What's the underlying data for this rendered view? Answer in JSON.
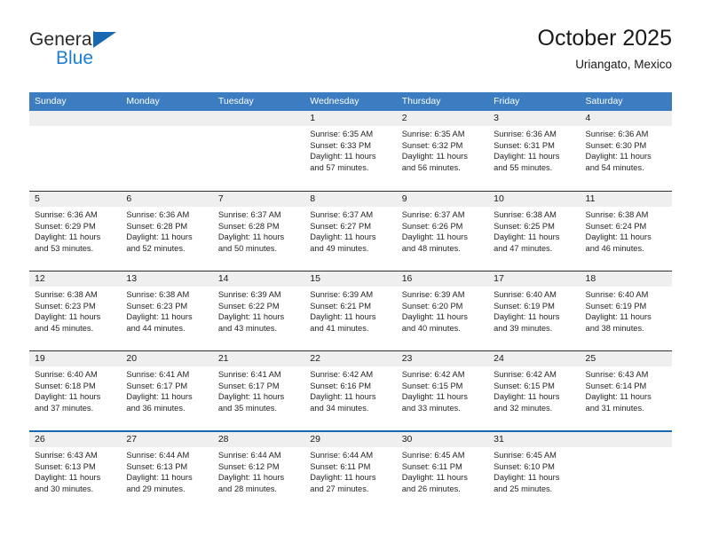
{
  "brand": {
    "name_part1": "General",
    "name_part2": "Blue",
    "flag_icon": "triangle-flag-icon"
  },
  "header": {
    "title": "October 2025",
    "subtitle": "Uriangato, Mexico"
  },
  "colors": {
    "header_blue": "#3b7dc0",
    "brand_blue": "#1d7fd4",
    "separator_blue": "#1668b3",
    "day_strip_grey": "#efefef",
    "week_border": "#2e2e2e"
  },
  "weekdays": [
    "Sunday",
    "Monday",
    "Tuesday",
    "Wednesday",
    "Thursday",
    "Friday",
    "Saturday"
  ],
  "labels": {
    "sunrise_prefix": "Sunrise:",
    "sunset_prefix": "Sunset:",
    "daylight_prefix": "Daylight:"
  },
  "weeks": [
    [
      {
        "day": "",
        "empty": true
      },
      {
        "day": "",
        "empty": true
      },
      {
        "day": "",
        "empty": true
      },
      {
        "day": "1",
        "line1": "Sunrise: 6:35 AM",
        "line2": "Sunset: 6:33 PM",
        "line3": "Daylight: 11 hours",
        "line4": "and 57 minutes."
      },
      {
        "day": "2",
        "line1": "Sunrise: 6:35 AM",
        "line2": "Sunset: 6:32 PM",
        "line3": "Daylight: 11 hours",
        "line4": "and 56 minutes."
      },
      {
        "day": "3",
        "line1": "Sunrise: 6:36 AM",
        "line2": "Sunset: 6:31 PM",
        "line3": "Daylight: 11 hours",
        "line4": "and 55 minutes."
      },
      {
        "day": "4",
        "line1": "Sunrise: 6:36 AM",
        "line2": "Sunset: 6:30 PM",
        "line3": "Daylight: 11 hours",
        "line4": "and 54 minutes."
      }
    ],
    [
      {
        "day": "5",
        "line1": "Sunrise: 6:36 AM",
        "line2": "Sunset: 6:29 PM",
        "line3": "Daylight: 11 hours",
        "line4": "and 53 minutes."
      },
      {
        "day": "6",
        "line1": "Sunrise: 6:36 AM",
        "line2": "Sunset: 6:28 PM",
        "line3": "Daylight: 11 hours",
        "line4": "and 52 minutes."
      },
      {
        "day": "7",
        "line1": "Sunrise: 6:37 AM",
        "line2": "Sunset: 6:28 PM",
        "line3": "Daylight: 11 hours",
        "line4": "and 50 minutes."
      },
      {
        "day": "8",
        "line1": "Sunrise: 6:37 AM",
        "line2": "Sunset: 6:27 PM",
        "line3": "Daylight: 11 hours",
        "line4": "and 49 minutes."
      },
      {
        "day": "9",
        "line1": "Sunrise: 6:37 AM",
        "line2": "Sunset: 6:26 PM",
        "line3": "Daylight: 11 hours",
        "line4": "and 48 minutes."
      },
      {
        "day": "10",
        "line1": "Sunrise: 6:38 AM",
        "line2": "Sunset: 6:25 PM",
        "line3": "Daylight: 11 hours",
        "line4": "and 47 minutes."
      },
      {
        "day": "11",
        "line1": "Sunrise: 6:38 AM",
        "line2": "Sunset: 6:24 PM",
        "line3": "Daylight: 11 hours",
        "line4": "and 46 minutes."
      }
    ],
    [
      {
        "day": "12",
        "line1": "Sunrise: 6:38 AM",
        "line2": "Sunset: 6:23 PM",
        "line3": "Daylight: 11 hours",
        "line4": "and 45 minutes."
      },
      {
        "day": "13",
        "line1": "Sunrise: 6:38 AM",
        "line2": "Sunset: 6:23 PM",
        "line3": "Daylight: 11 hours",
        "line4": "and 44 minutes."
      },
      {
        "day": "14",
        "line1": "Sunrise: 6:39 AM",
        "line2": "Sunset: 6:22 PM",
        "line3": "Daylight: 11 hours",
        "line4": "and 43 minutes."
      },
      {
        "day": "15",
        "line1": "Sunrise: 6:39 AM",
        "line2": "Sunset: 6:21 PM",
        "line3": "Daylight: 11 hours",
        "line4": "and 41 minutes."
      },
      {
        "day": "16",
        "line1": "Sunrise: 6:39 AM",
        "line2": "Sunset: 6:20 PM",
        "line3": "Daylight: 11 hours",
        "line4": "and 40 minutes."
      },
      {
        "day": "17",
        "line1": "Sunrise: 6:40 AM",
        "line2": "Sunset: 6:19 PM",
        "line3": "Daylight: 11 hours",
        "line4": "and 39 minutes."
      },
      {
        "day": "18",
        "line1": "Sunrise: 6:40 AM",
        "line2": "Sunset: 6:19 PM",
        "line3": "Daylight: 11 hours",
        "line4": "and 38 minutes."
      }
    ],
    [
      {
        "day": "19",
        "line1": "Sunrise: 6:40 AM",
        "line2": "Sunset: 6:18 PM",
        "line3": "Daylight: 11 hours",
        "line4": "and 37 minutes."
      },
      {
        "day": "20",
        "line1": "Sunrise: 6:41 AM",
        "line2": "Sunset: 6:17 PM",
        "line3": "Daylight: 11 hours",
        "line4": "and 36 minutes."
      },
      {
        "day": "21",
        "line1": "Sunrise: 6:41 AM",
        "line2": "Sunset: 6:17 PM",
        "line3": "Daylight: 11 hours",
        "line4": "and 35 minutes."
      },
      {
        "day": "22",
        "line1": "Sunrise: 6:42 AM",
        "line2": "Sunset: 6:16 PM",
        "line3": "Daylight: 11 hours",
        "line4": "and 34 minutes."
      },
      {
        "day": "23",
        "line1": "Sunrise: 6:42 AM",
        "line2": "Sunset: 6:15 PM",
        "line3": "Daylight: 11 hours",
        "line4": "and 33 minutes."
      },
      {
        "day": "24",
        "line1": "Sunrise: 6:42 AM",
        "line2": "Sunset: 6:15 PM",
        "line3": "Daylight: 11 hours",
        "line4": "and 32 minutes."
      },
      {
        "day": "25",
        "line1": "Sunrise: 6:43 AM",
        "line2": "Sunset: 6:14 PM",
        "line3": "Daylight: 11 hours",
        "line4": "and 31 minutes."
      }
    ],
    [
      {
        "day": "26",
        "line1": "Sunrise: 6:43 AM",
        "line2": "Sunset: 6:13 PM",
        "line3": "Daylight: 11 hours",
        "line4": "and 30 minutes."
      },
      {
        "day": "27",
        "line1": "Sunrise: 6:44 AM",
        "line2": "Sunset: 6:13 PM",
        "line3": "Daylight: 11 hours",
        "line4": "and 29 minutes."
      },
      {
        "day": "28",
        "line1": "Sunrise: 6:44 AM",
        "line2": "Sunset: 6:12 PM",
        "line3": "Daylight: 11 hours",
        "line4": "and 28 minutes."
      },
      {
        "day": "29",
        "line1": "Sunrise: 6:44 AM",
        "line2": "Sunset: 6:11 PM",
        "line3": "Daylight: 11 hours",
        "line4": "and 27 minutes."
      },
      {
        "day": "30",
        "line1": "Sunrise: 6:45 AM",
        "line2": "Sunset: 6:11 PM",
        "line3": "Daylight: 11 hours",
        "line4": "and 26 minutes."
      },
      {
        "day": "31",
        "line1": "Sunrise: 6:45 AM",
        "line2": "Sunset: 6:10 PM",
        "line3": "Daylight: 11 hours",
        "line4": "and 25 minutes."
      },
      {
        "day": "",
        "empty": true
      }
    ]
  ]
}
